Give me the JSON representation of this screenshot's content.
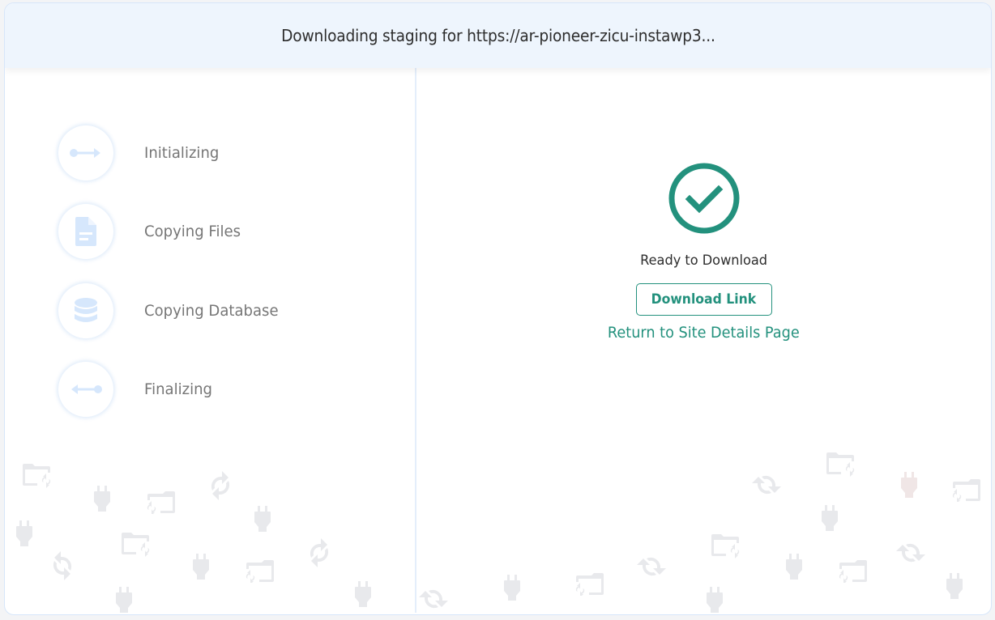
{
  "header": {
    "title": "Downloading staging for https://ar-pioneer-zicu-instawp3..."
  },
  "steps": [
    {
      "label": "Initializing",
      "icon": "arrow-right-icon"
    },
    {
      "label": "Copying Files",
      "icon": "file-icon"
    },
    {
      "label": "Copying Database",
      "icon": "database-icon"
    },
    {
      "label": "Finalizing",
      "icon": "arrow-left-icon"
    }
  ],
  "status": {
    "icon": "check-circle-icon",
    "text": "Ready to Download",
    "download_button_label": "Download Link",
    "return_link_label": "Return to Site Details Page"
  },
  "colors": {
    "accent": "#23917d",
    "header_bg": "#eef5fd",
    "step_icon": "#d6e7fc",
    "step_label": "#767676",
    "decor_icon": "#e8e9ec"
  }
}
